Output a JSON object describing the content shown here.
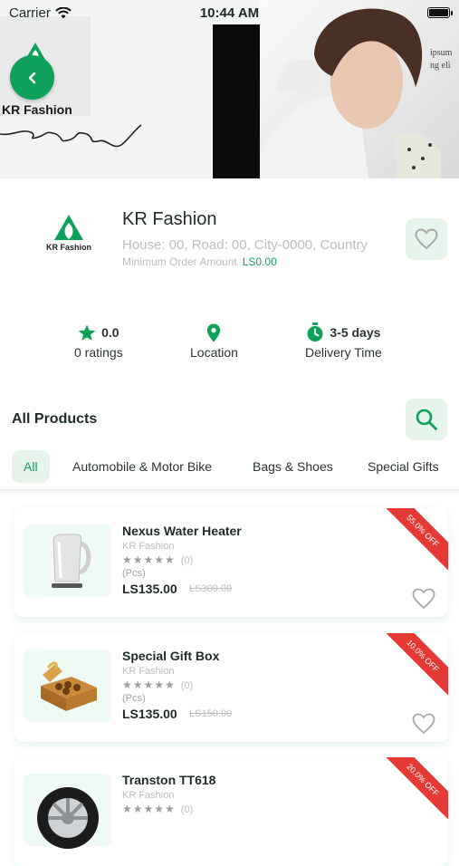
{
  "status_bar": {
    "carrier": "Carrier",
    "time": "10:44 AM"
  },
  "banner": {
    "logo_text": "KR Fashion",
    "photo_text_1": "ipsum",
    "photo_text_2": "ng eli"
  },
  "store": {
    "logo_text": "KR Fashion",
    "name": "KR Fashion",
    "address": "House: 00, Road: 00, City-0000, Country",
    "min_order_label": "Minimum Order Amount",
    "min_order_value": "LS0.00"
  },
  "stats": {
    "rating_value": "0.0",
    "rating_label": "0 ratings",
    "location_label": "Location",
    "delivery_value": "3-5 days",
    "delivery_label": "Delivery Time"
  },
  "products_section": {
    "title": "All Products"
  },
  "tabs": [
    {
      "label": "All",
      "active": true
    },
    {
      "label": "Automobile & Motor Bike",
      "active": false
    },
    {
      "label": "Bags & Shoes",
      "active": false
    },
    {
      "label": "Special Gifts",
      "active": false
    }
  ],
  "products": [
    {
      "name": "Nexus Water Heater",
      "store": "KR Fashion",
      "rating_count": "(0)",
      "unit": "(Pcs)",
      "price": "LS135.00",
      "old_price": "LS300.00",
      "discount": "55.0% OFF"
    },
    {
      "name": "Special Gift Box",
      "store": "KR Fashion",
      "rating_count": "(0)",
      "unit": "(Pcs)",
      "price": "LS135.00",
      "old_price": "LS150.00",
      "discount": "10.0% OFF"
    },
    {
      "name": "Transton TT618",
      "store": "KR Fashion",
      "rating_count": "(0)",
      "unit": "",
      "price": "",
      "old_price": "",
      "discount": "20.0% OFF"
    }
  ],
  "colors": {
    "accent": "#0fa05a",
    "accent_light": "#e6f4ec",
    "discount": "#e53935"
  }
}
